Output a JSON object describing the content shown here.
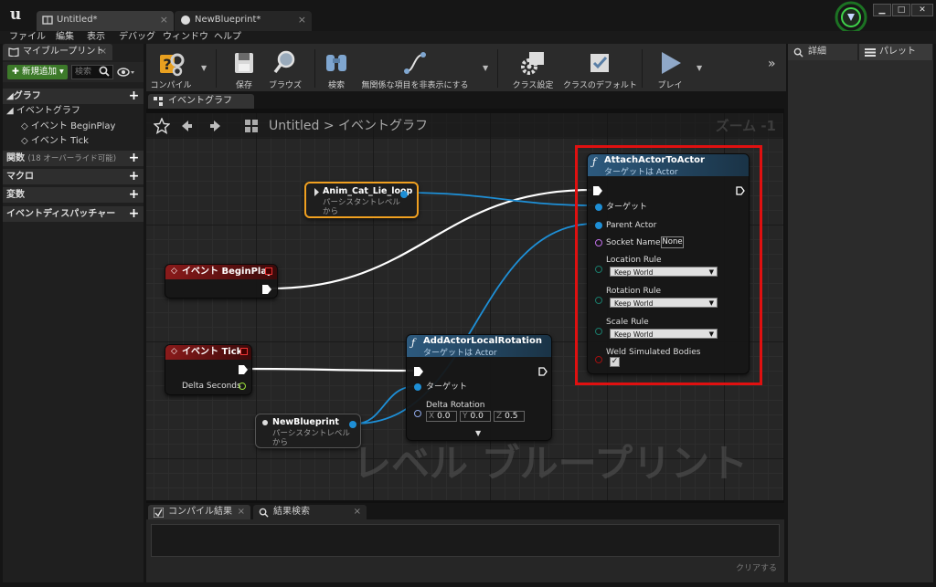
{
  "window": {
    "tabs": [
      {
        "label": "Untitled*"
      },
      {
        "label": "NewBlueprint*"
      }
    ],
    "controls": {
      "minimize": "▁",
      "maximize": "□",
      "close": "✕"
    }
  },
  "menu": [
    "ファイル",
    "編集",
    "表示",
    "デバッグ",
    "ウィンドウ",
    "ヘルプ"
  ],
  "left_panel": {
    "tab_label": "マイブループリント",
    "add_new": "✚ 新規追加 ▾",
    "search_placeholder": "検索",
    "sections": {
      "graphs": "◢グラフ",
      "event_graph": "◢ イベントグラフ",
      "event_beginplay": "イベント BeginPlay",
      "event_tick": "イベント Tick",
      "functions": "関数",
      "functions_sub": "(18 オーバーライド可能)",
      "macros": "マクロ",
      "variables": "変数",
      "dispatchers": "イベントディスパッチャー"
    }
  },
  "toolbar": {
    "compile": "コンパイル",
    "save": "保存",
    "browse": "ブラウズ",
    "find": "検索",
    "hide_unrelated": "無関係な項目を非表示にする",
    "class_settings": "クラス設定",
    "class_defaults": "クラスのデフォルト",
    "play": "プレイ"
  },
  "right_panel": {
    "details": "詳細",
    "palette": "パレット"
  },
  "graph": {
    "tab_label": "イベントグラフ",
    "breadcrumb_root": "Untitled",
    "breadcrumb_sep": ">",
    "breadcrumb_leaf": "イベントグラフ",
    "zoom": "ズーム -1",
    "watermark": "レベル ブループリント"
  },
  "nodes": {
    "anim_ref": {
      "title": "Anim_Cat_Lie_loop",
      "subtitle": "パーシスタントレベル",
      "subtitle2": "から"
    },
    "begin_play": {
      "title": "イベント BeginPlay"
    },
    "event_tick": {
      "title": "イベント Tick",
      "delta": "Delta Seconds"
    },
    "newbp_ref": {
      "title": "NewBlueprint",
      "subtitle": "パーシスタントレベル",
      "subtitle2": "から"
    },
    "attach": {
      "title": "AttachActorToActor",
      "subtitle": "ターゲットは Actor",
      "target": "ターゲット",
      "parent": "Parent Actor",
      "socket": "Socket Name",
      "socket_value": "None",
      "loc_rule": "Location Rule",
      "rot_rule": "Rotation Rule",
      "scale_rule": "Scale Rule",
      "rule_value": "Keep World",
      "weld": "Weld Simulated Bodies"
    },
    "add_rot": {
      "title": "AddActorLocalRotation",
      "subtitle": "ターゲットは Actor",
      "target": "ターゲット",
      "delta": "Delta Rotation",
      "x": "0.0",
      "y": "0.0",
      "z": "0.5",
      "x_label": "X",
      "y_label": "Y",
      "z_label": "Z"
    }
  },
  "bottom": {
    "compile_results": "コンパイル結果",
    "find_results": "結果検索",
    "clear": "クリアする"
  },
  "colors": {
    "exec_wire": "#ffffff",
    "object_wire": "#1e8fd6",
    "highlight": "#e01010",
    "func_header": "#2a4f6e",
    "event_header": "#7a1414",
    "selected_outline": "#f0a020"
  }
}
